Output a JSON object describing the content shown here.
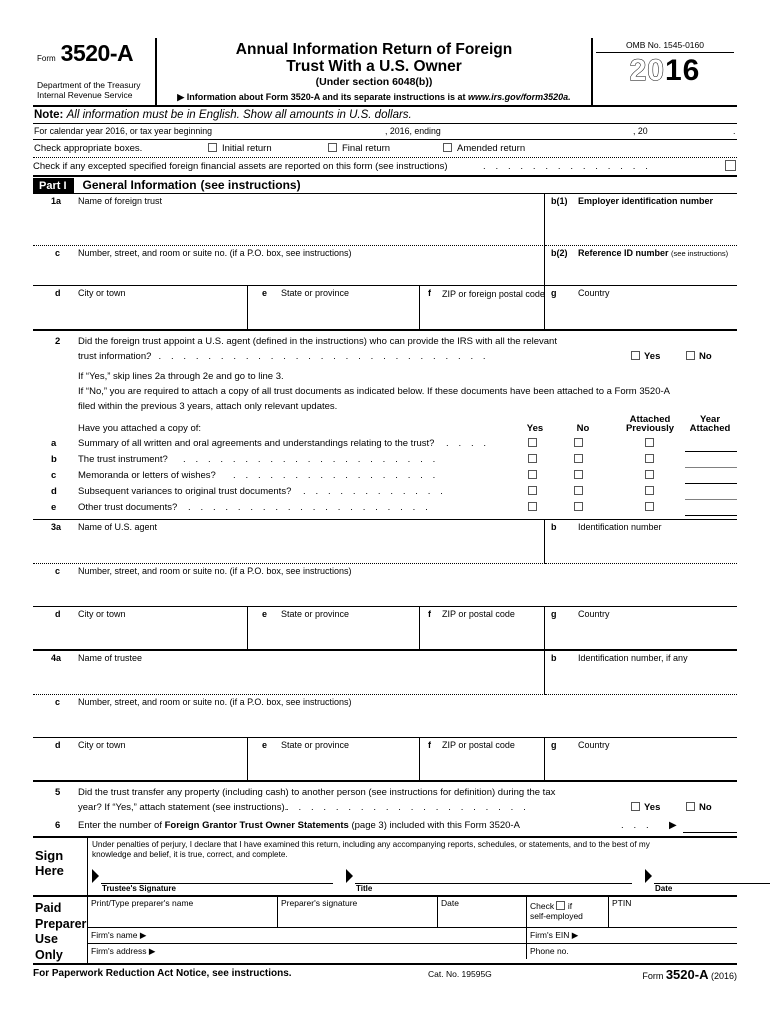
{
  "header": {
    "form_word": "Form",
    "form_number": "3520-A",
    "department_line1": "Department of the Treasury",
    "department_line2": "Internal Revenue Service",
    "title_line1": "Annual Information Return of Foreign",
    "title_line2": "Trust With a U.S. Owner",
    "subtitle": "(Under section 6048(b))",
    "info_arrow": "▶",
    "info_text": "Information about Form 3520-A and its separate instructions is at ",
    "info_url": "www.irs.gov/form3520a.",
    "omb": "OMB No. 1545-0160",
    "year_ghost": "20",
    "year_solid": "16"
  },
  "note": {
    "label": "Note:",
    "text": "All information must be in English. Show all amounts in U.S. dollars."
  },
  "calendar_row": {
    "text": "For calendar year 2016, or tax year beginning",
    "mid": ", 2016, ending",
    "right": ", 20",
    "end": "."
  },
  "check_row": {
    "label": "Check appropriate boxes.",
    "options": [
      "Initial return",
      "Final return",
      "Amended return"
    ]
  },
  "excepted_row": {
    "text": "Check if any excepted specified foreign financial assets are reported on this form (see instructions)",
    "leaders": ". . . . . . . . . . . . . ."
  },
  "part1": {
    "tab": "Part I",
    "title": "General Information",
    "note": "(see instructions)"
  },
  "trust": {
    "line1a_no": "1a",
    "line1a_cap": "Name of foreign trust",
    "b1_no": "b(1)",
    "b1_cap": "Employer identification number",
    "c_no": "c",
    "c_cap": "Number, street, and room or suite no. (if a P.O. box, see instructions)",
    "b2_no": "b(2)",
    "b2_cap": "Reference ID number",
    "b2_cap_sm": "(see instructions)",
    "d_no": "d",
    "d_cap": "City or town",
    "e_no": "e",
    "e_cap": "State or province",
    "f_no": "f",
    "f_cap": "ZIP or foreign postal code",
    "g_no": "g",
    "g_cap": "Country"
  },
  "question2": {
    "no": "2",
    "line1": "Did the foreign trust appoint a U.S. agent (defined in the instructions) who can provide the IRS with all the relevant",
    "line2": "trust information?",
    "leaders2": ". . . . . . . . . . . . . . . . . . . . . . . . . . . .",
    "yes": "Yes",
    "no_label": "No",
    "line3": "If “Yes,” skip lines 2a through 2e and go to line 3.",
    "line4": "If “No,” you are required to attach a copy of all trust documents as indicated below. If these documents have been attached to a Form 3520-A",
    "line5": "filed within the previous 3 years, attach only relevant updates.",
    "line6": "Have you attached a copy of:"
  },
  "attach_table": {
    "columns": [
      "Yes",
      "No",
      "Attached\nPreviously",
      "Year\nAttached"
    ],
    "col_yes": "Yes",
    "col_no": "No",
    "col_prev_l1": "Attached",
    "col_prev_l2": "Previously",
    "col_year_l1": "Year",
    "col_year_l2": "Attached",
    "rows": [
      {
        "letter": "a",
        "text": "Summary of all written and oral agreements and understandings relating to the trust?",
        "leaders": ". . . ."
      },
      {
        "letter": "b",
        "text": "The trust instrument?",
        "leaders": ". . . . . . . . . . . . . . . . . . . . ."
      },
      {
        "letter": "c",
        "text": "Memoranda or letters of wishes?",
        "leaders": ". . . . . . . . . . . . . . . . ."
      },
      {
        "letter": "d",
        "text": "Subsequent variances to original trust documents?",
        "leaders": ". . . . . . . . . . . ."
      },
      {
        "letter": "e",
        "text": "Other trust documents?",
        "leaders": ". . . . . . . . . . . . . . . . . . . ."
      }
    ]
  },
  "agent": {
    "a_no": "3a",
    "a_cap": "Name of U.S. agent",
    "b_no": "b",
    "b_cap": "Identification number",
    "c_no": "c",
    "c_cap": "Number, street, and room or suite no. (if a P.O. box, see instructions)",
    "d_no": "d",
    "d_cap": "City or town",
    "e_no": "e",
    "e_cap": "State or province",
    "f_no": "f",
    "f_cap": "ZIP or postal code",
    "g_no": "g",
    "g_cap": "Country"
  },
  "trustee": {
    "a_no": "4a",
    "a_cap": "Name of trustee",
    "b_no": "b",
    "b_cap": "Identification number, if any",
    "c_no": "c",
    "c_cap": "Number, street, and room or suite no. (if a P.O. box, see instructions)",
    "d_no": "d",
    "d_cap": "City or town",
    "e_no": "e",
    "e_cap": "State or province",
    "f_no": "f",
    "f_cap": "ZIP or postal code",
    "g_no": "g",
    "g_cap": "Country"
  },
  "question5": {
    "no": "5",
    "line1": "Did the trust transfer any property (including cash) to another person (see instructions for definition) during the tax",
    "line2": "year? If “Yes,” attach statement (see instructions).",
    "leaders": ". . . . . . . . . . . . . . . . . . . .",
    "yes": "Yes",
    "no_label": "No"
  },
  "question6": {
    "no": "6",
    "text_pre": "Enter the number of ",
    "text_bold": "Foreign Grantor Trust Owner Statements",
    "text_post": " (page 3) included with this Form 3520-A ",
    "leaders": ". . .",
    "arrow": "▶"
  },
  "sign": {
    "label_l1": "Sign",
    "label_l2": "Here",
    "perjury_l1": "Under penalties of perjury, I declare that I have examined this return, including any accompanying reports, schedules, or statements, and to the best of my",
    "perjury_l2": "knowledge and belief, it is true, correct, and complete.",
    "field_signature": "Trustee's Signature",
    "field_title": "Title",
    "field_date": "Date"
  },
  "preparer": {
    "label_l1": "Paid",
    "label_l2": "Preparer",
    "label_l3": "Use Only",
    "name_cap": "Print/Type preparer's name",
    "signature_cap": "Preparer's signature",
    "date_cap": "Date",
    "selfemp_l1": "Check",
    "selfemp_if": "if",
    "selfemp_l2": "self-employed",
    "ptin_cap": "PTIN",
    "firm_name": "Firm's name",
    "firm_ein": "Firm's EIN",
    "firm_address": "Firm's address",
    "phone": "Phone no.",
    "arrow": "▶"
  },
  "footer": {
    "left": "For Paperwork Reduction Act Notice, see instructions.",
    "center": "Cat. No. 19595G",
    "right_form": "Form ",
    "right_num": "3520-A",
    "right_year": " (2016)"
  }
}
